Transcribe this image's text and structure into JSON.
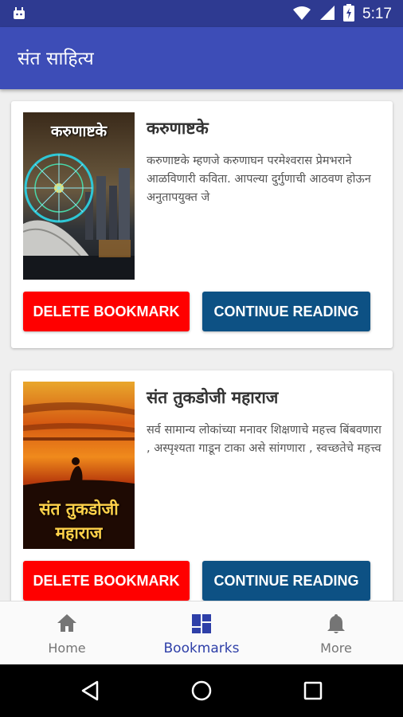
{
  "status_bar": {
    "time": "5:17"
  },
  "app_bar": {
    "title": "संत साहित्य"
  },
  "bookmarks": [
    {
      "cover_title": "करुणाष्टके",
      "title": "करुणाष्टके",
      "description": "करुणाष्टके म्हणजे करुणाघन परमेश्वरास प्रेमभराने आळविणारी कविता. आपल्या दुर्गुणाची आठवण होऊन अनुतापयुक्त जे",
      "delete_label": "DELETE BOOKMARK",
      "continue_label": "CONTINUE READING"
    },
    {
      "cover_title": "संत तुकडोजी महाराज",
      "title": "संत तुकडोजी महाराज",
      "description": "सर्व सामान्य लोकांच्या मनावर शिक्षणाचे महत्त्व बिंबवणारा , अस्पृश्यता गाडून टाका असे सांगणारा , स्वच्छतेचे महत्त्व",
      "delete_label": "DELETE BOOKMARK",
      "continue_label": "CONTINUE READING"
    }
  ],
  "bottom_nav": {
    "items": [
      {
        "label": "Home",
        "icon": "home-icon"
      },
      {
        "label": "Bookmarks",
        "icon": "dashboard-icon"
      },
      {
        "label": "More",
        "icon": "bell-icon"
      }
    ],
    "active_index": 1
  },
  "colors": {
    "primary": "#3d4db7",
    "primary_dark": "#2e3a91",
    "delete": "#ff0000",
    "continue": "#0d5184"
  }
}
